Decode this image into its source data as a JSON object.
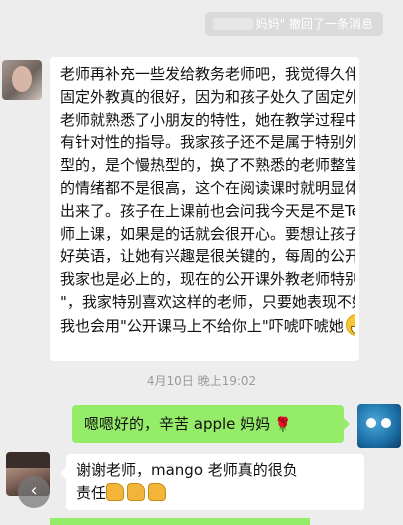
{
  "recall_notice": {
    "name_suffix": "妈妈",
    "text": "妈妈\" 撤回了一条消息"
  },
  "messages": [
    {
      "id": "teacher-praise",
      "side": "left",
      "lines": [
        "老师再补充一些发给教务老师吧，我觉得久伴的",
        "固定外教真的很好，因为和孩子处久了固定外教",
        "老师就熟悉了小朋友的特性，她在教学过程中会",
        "有针对性的指导。我家孩子还不是属于特别外向",
        "型的，是个慢热型的，换了不熟悉的老师整堂课",
        "的情绪都不是很高，这个在阅读课时就明显体现",
        "出来了。孩子在上课前也会问我今天是不是Tea老",
        "师上课，如果是的话就会很开心。要想让孩子学",
        "好英语，让她有兴趣是很关键的，每周的公开课",
        "我家也是必上的，现在的公开课外教老师特别\"嗨",
        "\"，我家特别喜欢这样的老师，只要她表现不好时",
        "我也会用\"公开课马上不给你上\"吓唬吓唬她"
      ],
      "trailing_emoji": "grin-emoji"
    }
  ],
  "timestamp": "4月10日 晚上19:02",
  "reply_green": {
    "text": "嗯嗯好的，辛苦 apple 妈妈",
    "emoji": "🌹"
  },
  "reply_white": {
    "line1": "谢谢老师，mango 老师真的很负",
    "line2": "责任",
    "emoji_count": "3",
    "emoji": "thumbs-up-icon"
  },
  "colors": {
    "background": "#ededed",
    "bubble_self": "#95ec69",
    "bubble_other": "#ffffff",
    "timestamp": "#9a9a9a"
  }
}
